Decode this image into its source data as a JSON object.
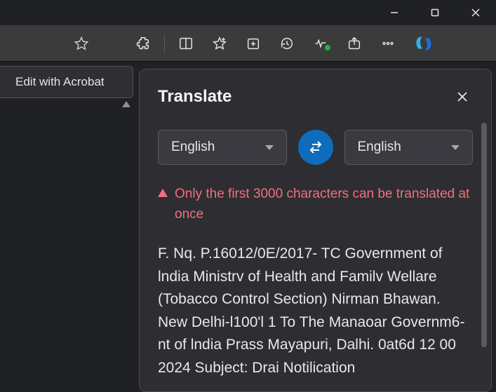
{
  "window": {
    "min_label": "minimize",
    "max_label": "maximize",
    "close_label": "close"
  },
  "toolbar": {
    "favorite": "favorite-star",
    "extensions": "extensions",
    "split": "split-screen",
    "favorites": "favorites",
    "collections": "collections",
    "history": "history",
    "health": "browser-essentials",
    "share": "share",
    "more": "more",
    "copilot": "copilot"
  },
  "left": {
    "acrobat_label": "Edit with Acrobat"
  },
  "panel": {
    "title": "Translate",
    "close": "close",
    "source_lang": "English",
    "target_lang": "English",
    "swap": "swap-languages",
    "warning": "Only the first 3000 characters can be translated at once",
    "output": "F. Nq. P.16012/0E/2017- TC Government of lndia Ministrv of Health and Familv Wellare (Tobacco Control Section) Nirman Bhawan. New Delhi-l100'l 1 To The Manaoar Governm6-nt of lndia Prass Mayapuri, Dalhi. 0at6d 12 00 2024 Subject: Drai Notilication"
  }
}
